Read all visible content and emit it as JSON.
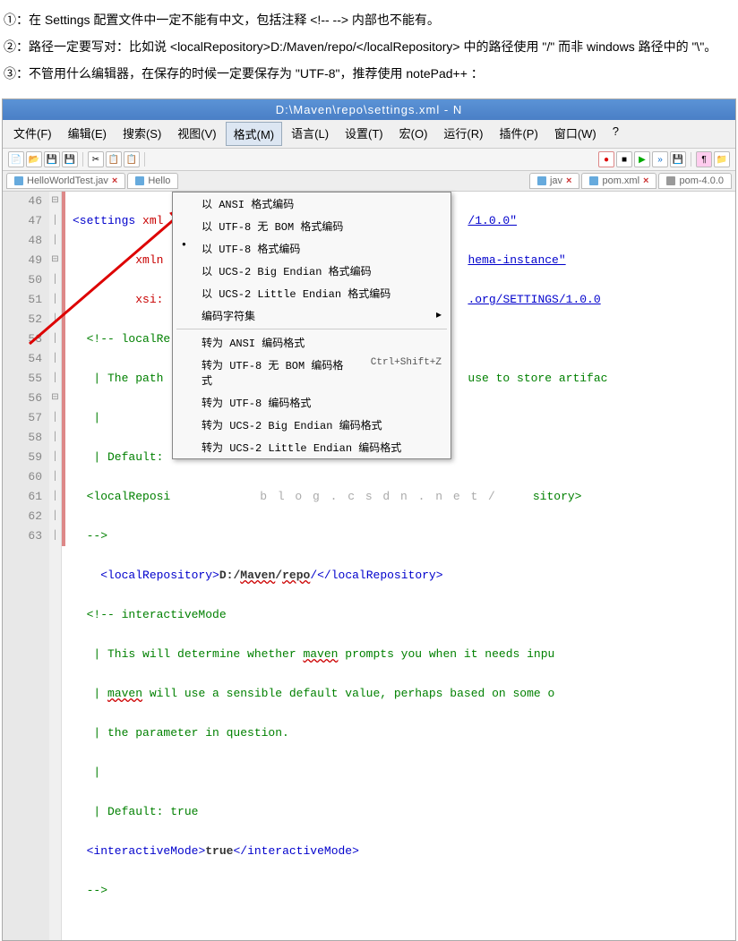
{
  "notes": {
    "l1": "①：在  Settings  配置文件中一定不能有中文，包括注释  <!--  -->  内部也不能有。",
    "l2": "②：路径一定要写对：比如说  <localRepository>D:/Maven/repo/</localRepository>  中的路径使用 \"/\"  而非  windows 路径中的  \"\\\"。",
    "l3": "③：不管用什么编辑器，在保存的时候一定要保存为   \"UTF-8\"，推荐使用   notePad++ ："
  },
  "window": {
    "title": "D:\\Maven\\repo\\settings.xml - N"
  },
  "menu": {
    "file": "文件(F)",
    "edit": "编辑(E)",
    "search": "搜索(S)",
    "view": "视图(V)",
    "format": "格式(M)",
    "language": "语言(L)",
    "settings": "设置(T)",
    "macro": "宏(O)",
    "run": "运行(R)",
    "plugins": "插件(P)",
    "window": "窗口(W)",
    "help": "?"
  },
  "dropdown": {
    "i1": "以 ANSI 格式编码",
    "i2": "以 UTF-8 无 BOM 格式编码",
    "i3": "以 UTF-8 格式编码",
    "i4": "以 UCS-2 Big Endian 格式编码",
    "i5": "以 UCS-2 Little Endian 格式编码",
    "i6": "编码字符集",
    "i7": "转为 ANSI 编码格式",
    "i8": "转为 UTF-8 无 BOM 编码格式",
    "i8s": "Ctrl+Shift+Z",
    "i9": "转为 UTF-8 编码格式",
    "i10": "转为 UCS-2 Big Endian 编码格式",
    "i11": "转为 UCS-2 Little Endian 编码格式"
  },
  "tabs": {
    "t1": "HelloWorldTest.jav",
    "t2": "Hello",
    "t3": "jav",
    "t4": "pom.xml",
    "t5": "pom-4.0.0"
  },
  "lines": {
    "n46": "46",
    "n47": "47",
    "n48": "48",
    "n49": "49",
    "n50": "50",
    "n51": "51",
    "n52": "52",
    "n53": "53",
    "n54": "54",
    "n55": "55",
    "n56": "56",
    "n57": "57",
    "n58": "58",
    "n59": "59",
    "n60": "60",
    "n61": "61",
    "n62": "62",
    "n63": "63"
  },
  "code": {
    "l46a": "<settings ",
    "l46b": "xml",
    "l46c": "/1.0.0\"",
    "l47a": "         ",
    "l47b": "xmln",
    "l47c": "hema-instance\"",
    "l48a": "         ",
    "l48b": "xsi:",
    "l48c": ".org/SETTINGS/1.0.0",
    "l49": "  <!-- localRe",
    "l50a": "   | The path",
    "l50b": "use to store artifac",
    "l51": "   |",
    "l52": "   | Default:",
    "l53a": "  <localReposi",
    "l53b_wm": "b l o g . c s d n . n e t /",
    "l53b": "sitory>",
    "l54": "  -->",
    "l55a": "    <",
    "l55b": "localRepository",
    "l55c": ">",
    "l55d": "D:/",
    "l55e": "Maven",
    "l55f": "/",
    "l55g": "repo",
    "l55h": "/</",
    "l55i": "localRepository",
    "l55j": ">",
    "l56": "  <!-- interactiveMode",
    "l57a": "   | This will determine whether ",
    "l57b": "maven",
    "l57c": " prompts you when it needs inpu",
    "l58a": "   | ",
    "l58b": "maven",
    "l58c": " will use a sensible default value, perhaps based on some o",
    "l59": "   | the parameter in question.",
    "l60": "   |",
    "l61": "   | Default: true",
    "l62a": "  <",
    "l62b": "interactiveMode",
    "l62c": ">",
    "l62d": "true",
    "l62e": "</",
    "l62f": "interactiveMode",
    "l62g": ">",
    "l63": "  -->"
  }
}
